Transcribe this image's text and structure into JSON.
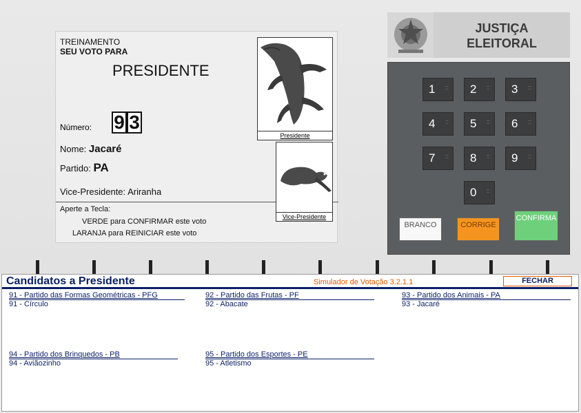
{
  "screen": {
    "training": "TREINAMENTO",
    "your_vote_for": "SEU VOTO PARA",
    "office": "PRESIDENTE",
    "number_label": "Número:",
    "digits": [
      "9",
      "3"
    ],
    "name_label": "Nome:",
    "name_value": "Jacaré",
    "party_label": "Partido:",
    "party_value": "PA",
    "vice_label": "Vice-Presidente:",
    "vice_value": "Ariranha",
    "press_key": "Aperte a Tecla:",
    "green_key": "VERDE",
    "green_text": "para CONFIRMAR este voto",
    "orange_key": "LARANJA",
    "orange_text": "para REINICIAR este voto",
    "photo_president_caption": "Presidente",
    "photo_vice_caption": "Vice-Presidente"
  },
  "header": {
    "line1": "JUSTIÇA",
    "line2": "ELEITORAL"
  },
  "keypad": {
    "keys": [
      "1",
      "2",
      "3",
      "4",
      "5",
      "6",
      "7",
      "8",
      "9",
      "0"
    ],
    "branco": "BRANCO",
    "corrige": "CORRIGE",
    "confirma": "CONFIRMA"
  },
  "candidates_panel": {
    "title": "Candidatos a Presidente",
    "simulator": "Simulador de Votação 3.2.1.1",
    "close": "FECHAR",
    "parties": [
      {
        "party": "91 - Partido das Formas Geométricas - PFG",
        "candidate": "91 - Círculo"
      },
      {
        "party": "92 - Partido das Frutas - PF",
        "candidate": "92 - Abacate"
      },
      {
        "party": "93 - Partido dos Animais - PA",
        "candidate": "93 - Jacaré"
      },
      {
        "party": "94 - Partido dos Brinquedos - PB",
        "candidate": "94 - Aviãozinho"
      },
      {
        "party": "95 - Partido dos Esportes - PE",
        "candidate": "95 - Atletismo"
      }
    ]
  },
  "colors": {
    "panel_title": "#0a1f66",
    "simulator_text": "#e05a00",
    "corrige": "#f59520",
    "confirma": "#6ed07a"
  }
}
